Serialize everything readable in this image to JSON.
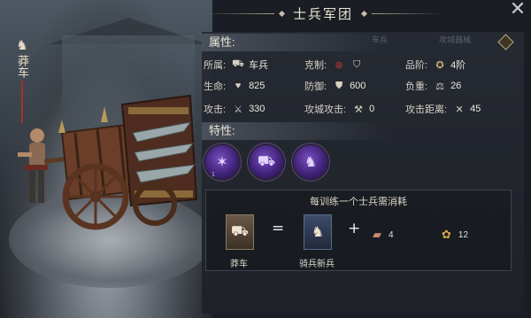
{
  "header": {
    "title": "士兵军团",
    "close_icon": "close-x"
  },
  "unit_tag": {
    "emblem_icon": "horse-head-icon",
    "name": "莽车"
  },
  "attributes": {
    "section_label": "属性:",
    "ghost_tabs": [
      "车兵",
      "攻城器械"
    ],
    "stats": [
      {
        "key": "type",
        "label": "所属:",
        "icon": "cart-icon",
        "value": "车兵"
      },
      {
        "key": "counter",
        "label": "克制:",
        "icon": "counter-icons",
        "value": ""
      },
      {
        "key": "rank",
        "label": "品阶:",
        "icon": "rank-badge-icon",
        "value": "4阶"
      },
      {
        "key": "hp",
        "label": "生命:",
        "icon": "heart-icon",
        "value": "825"
      },
      {
        "key": "defense",
        "label": "防御:",
        "icon": "shield-icon",
        "value": "600"
      },
      {
        "key": "load",
        "label": "负重:",
        "icon": "scale-icon",
        "value": "26"
      },
      {
        "key": "attack",
        "label": "攻击:",
        "icon": "sword-icon",
        "value": "330"
      },
      {
        "key": "siege",
        "label": "攻城攻击:",
        "icon": "siege-icon",
        "value": "0"
      },
      {
        "key": "range",
        "label": "攻击距离:",
        "icon": "crossed-arrows-icon",
        "value": "45"
      }
    ]
  },
  "traits": {
    "section_label": "特性:",
    "items": [
      {
        "icon": "spiked-claw-icon",
        "level": "1"
      },
      {
        "icon": "cart-charge-icon",
        "level": ""
      },
      {
        "icon": "horse-rider-icon",
        "level": ""
      }
    ]
  },
  "cost": {
    "title": "每训练一个士兵需消耗",
    "result_label": "莽车",
    "ingredient_label": "骑兵新兵",
    "equals": "=",
    "plus": "+",
    "resources": [
      {
        "icon": "wood-icon",
        "amount": "4"
      },
      {
        "icon": "grain-icon",
        "amount": "12"
      }
    ]
  },
  "colors": {
    "accent_red": "#a5322a",
    "trait_purple": "#41237a",
    "gold": "#b7a47a"
  }
}
